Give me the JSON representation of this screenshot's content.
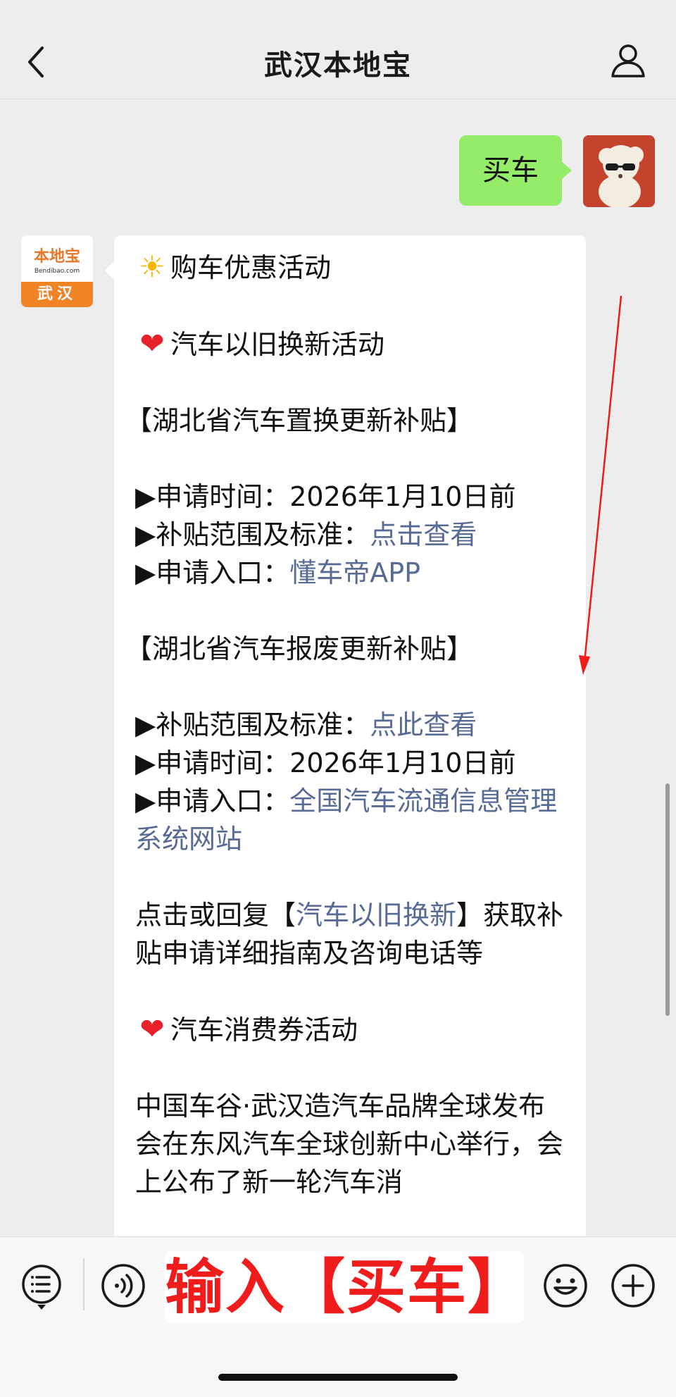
{
  "header": {
    "title": "武汉本地宝"
  },
  "conversation": {
    "user_message": "买车",
    "bot_avatar": {
      "brand": "本地宝",
      "site": "Bendibao.com",
      "city": "武汉"
    },
    "bot_message": {
      "heading": "购车优惠活动",
      "section1_title": "汽车以旧换新活动",
      "block1_title": "【湖北省汽车置换更新补贴】",
      "block1_time": "▶申请时间：2026年1月10日前",
      "block1_scope_label": "▶补贴范围及标准：",
      "block1_scope_link": "点击查看",
      "block1_entry_label": "▶申请入口：",
      "block1_entry_link": "懂车帝APP",
      "block2_title": "【湖北省汽车报废更新补贴】",
      "block2_scope_label": "▶补贴范围及标准：",
      "block2_scope_link": "点此查看",
      "block2_time": "▶申请时间：2026年1月10日前",
      "block2_entry_label": "▶申请入口：",
      "block2_entry_link": "全国汽车流通信息管理系统网站",
      "reply_prefix": "点击或回复【",
      "reply_link": "汽车以旧换新",
      "reply_suffix": "】获取补贴申请详细指南及咨询电话等",
      "section2_title": "汽车消费券活动",
      "section2_text": "中国车谷·武汉造汽车品牌全球发布会在东风汽车全球创新中心举行，会上公布了新一轮汽车消"
    }
  },
  "input_bar": {
    "value": "输入【买车】"
  },
  "colors": {
    "user_bubble": "#95ec69",
    "link": "#576b95",
    "annotation_red": "#f01c1c",
    "brand_orange": "#f08324"
  },
  "icons": [
    "back-icon",
    "profile-icon",
    "menu-list-icon",
    "voice-icon",
    "emoji-icon",
    "plus-icon",
    "sun-icon",
    "heart-icon"
  ]
}
